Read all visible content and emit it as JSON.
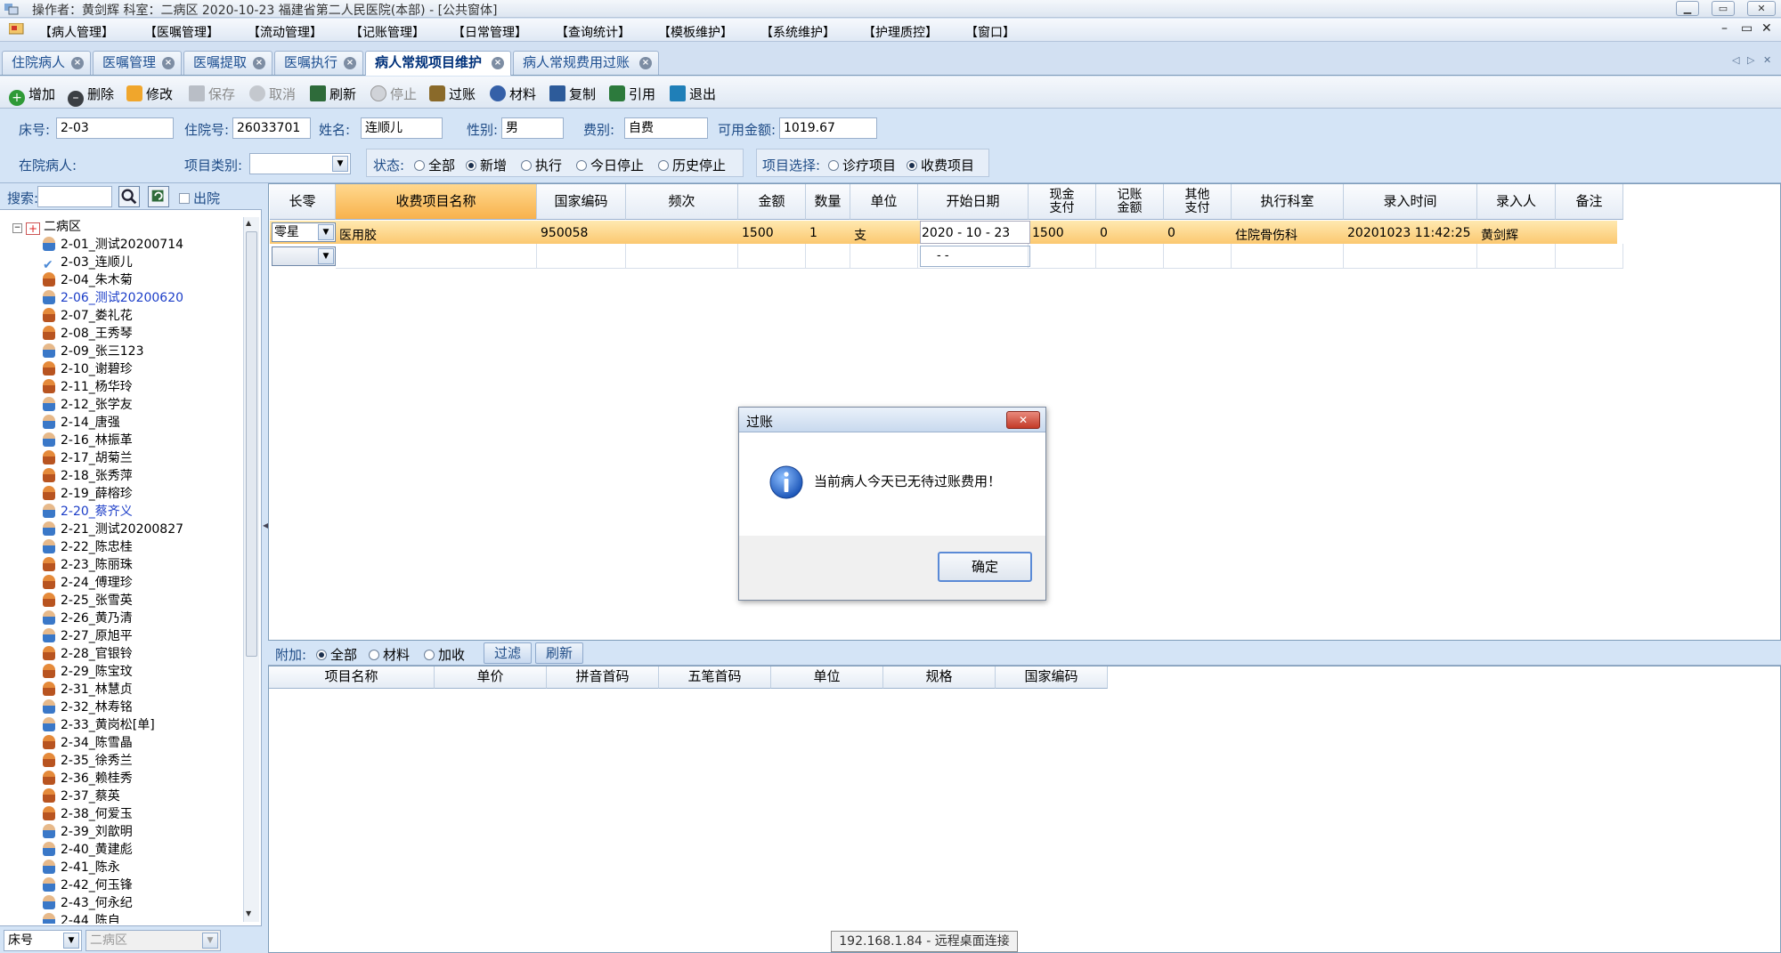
{
  "window": {
    "title": "操作者：黄剑辉  科室：二病区  2020-10-23  福建省第二人民医院(本部) - [公共窗体]",
    "min_icon": "minimize-icon",
    "restore_icon": "restore-icon",
    "close_icon": "close-icon"
  },
  "menu": {
    "items": [
      "【病人管理】",
      "【医嘱管理】",
      "【流动管理】",
      "【记账管理】",
      "【日常管理】",
      "【查询统计】",
      "【模板维护】",
      "【系统维护】",
      "【护理质控】",
      "【窗口】"
    ],
    "mdi_buttons": [
      "–",
      "▭",
      "✕"
    ]
  },
  "tabs": {
    "items": [
      {
        "label": "住院病人",
        "active": false
      },
      {
        "label": "医嘱管理",
        "active": false
      },
      {
        "label": "医嘱提取",
        "active": false
      },
      {
        "label": "医嘱执行",
        "active": false
      },
      {
        "label": "病人常规项目维护",
        "active": true
      },
      {
        "label": "病人常规费用过账",
        "active": false
      }
    ],
    "close_glyph": "×",
    "nav": [
      "◁",
      "▷",
      "✕"
    ]
  },
  "toolbar": {
    "add": "增加",
    "delete": "删除",
    "modify": "修改",
    "save": "保存",
    "cancel": "取消",
    "refresh": "刷新",
    "stop": "停止",
    "post": "过账",
    "material": "材料",
    "copy": "复制",
    "reference": "引用",
    "exit": "退出"
  },
  "form": {
    "bed_label": "床号:",
    "bed_value": "2-03",
    "inpatient_no_label": "住院号:",
    "inpatient_no_value": "26033701",
    "name_label": "姓名:",
    "name_value": "连顺儿",
    "sex_label": "性别:",
    "sex_value": "男",
    "fee_type_label": "费别:",
    "fee_type_value": "自费",
    "balance_label": "可用金额:",
    "balance_value": "1019.67",
    "inpatient_label": "在院病人:",
    "item_type_label": "项目类别:",
    "item_type_value": "",
    "status_label": "状态:",
    "status_options": [
      "全部",
      "新增",
      "执行",
      "今日停止",
      "历史停止"
    ],
    "status_selected": 1,
    "item_select_label": "项目选择:",
    "item_select_options": [
      "诊疗项目",
      "收费项目"
    ],
    "item_select_selected": 1
  },
  "search": {
    "label": "搜索:",
    "value": "",
    "discharged_label": "出院"
  },
  "tree": {
    "root": "二病区",
    "patients": [
      {
        "label": "2-01_测试20200714",
        "color": "blue-person",
        "highlight": false
      },
      {
        "label": "2-03_连顺儿",
        "color": "check",
        "highlight": false
      },
      {
        "label": "2-04_朱木菊",
        "color": "orange-person",
        "highlight": false
      },
      {
        "label": "2-06_测试20200620",
        "color": "blue-person",
        "highlight": true
      },
      {
        "label": "2-07_娄礼花",
        "color": "orange-person",
        "highlight": false
      },
      {
        "label": "2-08_王秀琴",
        "color": "orange-person",
        "highlight": false
      },
      {
        "label": "2-09_张三123",
        "color": "blue-person",
        "highlight": false
      },
      {
        "label": "2-10_谢碧珍",
        "color": "orange-person",
        "highlight": false
      },
      {
        "label": "2-11_杨华玲",
        "color": "orange-person",
        "highlight": false
      },
      {
        "label": "2-12_张学友",
        "color": "blue-person",
        "highlight": false
      },
      {
        "label": "2-14_唐强",
        "color": "blue-person",
        "highlight": false
      },
      {
        "label": "2-16_林振革",
        "color": "blue-person",
        "highlight": false
      },
      {
        "label": "2-17_胡菊兰",
        "color": "orange-person",
        "highlight": false
      },
      {
        "label": "2-18_张秀萍",
        "color": "orange-person",
        "highlight": false
      },
      {
        "label": "2-19_薛榕珍",
        "color": "orange-person",
        "highlight": false
      },
      {
        "label": "2-20_蔡齐义",
        "color": "blue-person",
        "highlight": true
      },
      {
        "label": "2-21_测试20200827",
        "color": "blue-person",
        "highlight": false
      },
      {
        "label": "2-22_陈忠桂",
        "color": "blue-person",
        "highlight": false
      },
      {
        "label": "2-23_陈丽珠",
        "color": "orange-person",
        "highlight": false
      },
      {
        "label": "2-24_傅理珍",
        "color": "orange-person",
        "highlight": false
      },
      {
        "label": "2-25_张雪英",
        "color": "orange-person",
        "highlight": false
      },
      {
        "label": "2-26_黄乃清",
        "color": "blue-person",
        "highlight": false
      },
      {
        "label": "2-27_原旭平",
        "color": "blue-person",
        "highlight": false
      },
      {
        "label": "2-28_官银铃",
        "color": "orange-person",
        "highlight": false
      },
      {
        "label": "2-29_陈宝玟",
        "color": "orange-person",
        "highlight": false
      },
      {
        "label": "2-31_林慧贞",
        "color": "orange-person",
        "highlight": false
      },
      {
        "label": "2-32_林寿铭",
        "color": "blue-person",
        "highlight": false
      },
      {
        "label": "2-33_黄岗松[单]",
        "color": "blue-person",
        "highlight": false
      },
      {
        "label": "2-34_陈雪晶",
        "color": "orange-person",
        "highlight": false
      },
      {
        "label": "2-35_徐秀兰",
        "color": "orange-person",
        "highlight": false
      },
      {
        "label": "2-36_赖桂秀",
        "color": "orange-person",
        "highlight": false
      },
      {
        "label": "2-37_蔡英",
        "color": "orange-person",
        "highlight": false
      },
      {
        "label": "2-38_何爱玉",
        "color": "orange-person",
        "highlight": false
      },
      {
        "label": "2-39_刘歆明",
        "color": "blue-person",
        "highlight": false
      },
      {
        "label": "2-40_黄建彪",
        "color": "blue-person",
        "highlight": false
      },
      {
        "label": "2-41_陈永",
        "color": "blue-person",
        "highlight": false
      },
      {
        "label": "2-42_何玉锋",
        "color": "blue-person",
        "highlight": false
      },
      {
        "label": "2-43_何永纪",
        "color": "blue-person",
        "highlight": false
      },
      {
        "label": "2-44_陈自",
        "color": "blue-person",
        "highlight": false
      }
    ]
  },
  "bottom_select": {
    "field": "床号",
    "ward": "二病区"
  },
  "grid": {
    "headers": [
      "长零",
      "收费项目名称",
      "国家编码",
      "频次",
      "金额",
      "数量",
      "单位",
      "开始日期",
      "现金支付",
      "记账金额",
      "其他支付",
      "执行科室",
      "录入时间",
      "录入人",
      "备注"
    ],
    "two_line_headers": {
      "8": [
        "现金",
        "支付"
      ],
      "9": [
        "记账",
        "金额"
      ],
      "10": [
        "其他",
        "支付"
      ]
    },
    "rows": [
      [
        "零星",
        "医用胶",
        "950058",
        "",
        "1500",
        "1",
        "支",
        "2020 - 10 - 23",
        "1500",
        "0",
        "0",
        "住院骨伤科",
        "20201023 11:42:25",
        "黄剑辉",
        ""
      ]
    ],
    "new_row_date": "-   -"
  },
  "addbar": {
    "label": "附加:",
    "options": [
      "全部",
      "材料",
      "加收"
    ],
    "selected": 0,
    "filter_btn": "过滤",
    "refresh_btn": "刷新"
  },
  "grid2": {
    "headers": [
      "项目名称",
      "单价",
      "拼音首码",
      "五笔首码",
      "单位",
      "规格",
      "国家编码"
    ]
  },
  "dialog": {
    "title": "过账",
    "message": "当前病人今天已无待过账费用！",
    "ok": "确定",
    "info_icon": "info-icon",
    "close_glyph": "✕"
  },
  "tooltip": "192.168.1.84 - 远程桌面连接"
}
